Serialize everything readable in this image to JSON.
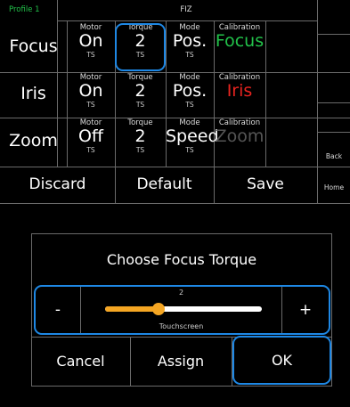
{
  "top": {
    "profile_label": "Profile 1",
    "title": "FIZ",
    "side_buttons": {
      "back": "Back",
      "home": "Home"
    },
    "rows": [
      {
        "label": "Focus",
        "motor": {
          "caption": "Motor",
          "value": "On",
          "sub": "TS"
        },
        "torque": {
          "caption": "Torque",
          "value": "2",
          "sub": "TS"
        },
        "mode": {
          "caption": "Mode",
          "value": "Pos.",
          "sub": "TS"
        },
        "calibration": {
          "caption": "Calibration",
          "value": "Focus",
          "color": "#22c24a"
        }
      },
      {
        "label": "Iris",
        "motor": {
          "caption": "Motor",
          "value": "On",
          "sub": "TS"
        },
        "torque": {
          "caption": "Torque",
          "value": "2",
          "sub": "TS"
        },
        "mode": {
          "caption": "Mode",
          "value": "Pos.",
          "sub": "TS"
        },
        "calibration": {
          "caption": "Calibration",
          "value": "Iris",
          "color": "#e8231f"
        }
      },
      {
        "label": "Zoom",
        "motor": {
          "caption": "Motor",
          "value": "Off",
          "sub": "TS"
        },
        "torque": {
          "caption": "Torque",
          "value": "2",
          "sub": "TS"
        },
        "mode": {
          "caption": "Mode",
          "value": "Speed",
          "sub": "TS"
        },
        "calibration": {
          "caption": "Calibration",
          "value": "Zoom",
          "color": "#555555"
        }
      }
    ],
    "bottom_buttons": {
      "discard": "Discard",
      "default": "Default",
      "save": "Save"
    }
  },
  "dialog": {
    "title": "Choose Focus Torque",
    "slider": {
      "minus": "-",
      "plus": "+",
      "value_label": "2",
      "source_label": "Touchscreen",
      "fill_fraction": 0.34,
      "fill_color": "#f5a623",
      "track_color": "#ffffff"
    },
    "buttons": {
      "cancel": "Cancel",
      "assign": "Assign",
      "ok": "OK"
    }
  },
  "colors": {
    "highlight": "#1e88e5",
    "profile_green": "#22c24a",
    "grid": "#6a6a6a"
  }
}
